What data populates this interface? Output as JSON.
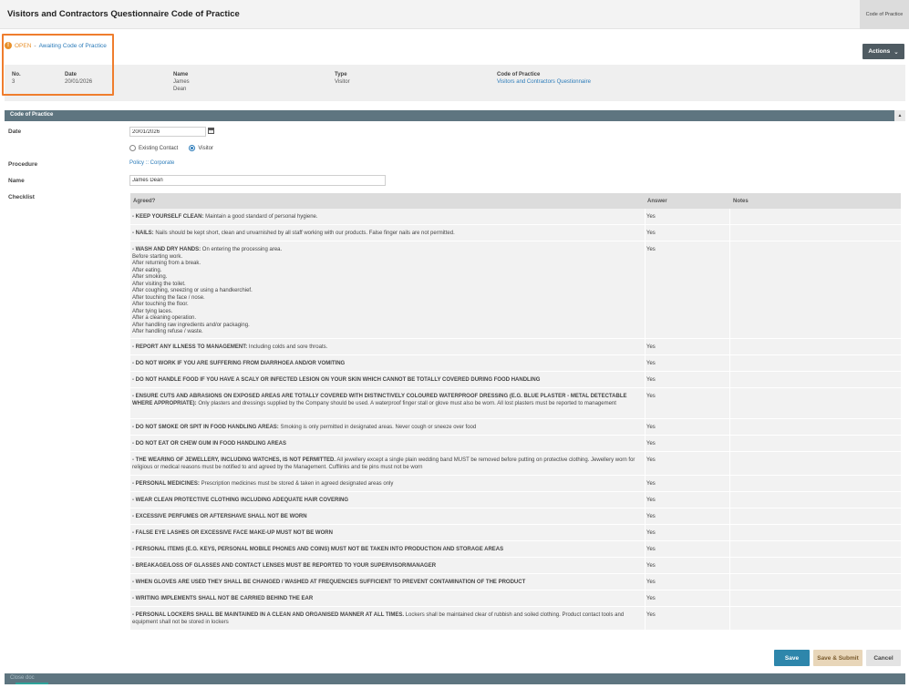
{
  "header": {
    "title": "Visitors and Contractors Questionnaire Code of Practice",
    "tab_label": "Code of Practice"
  },
  "status": {
    "icon": "!",
    "state": "OPEN",
    "separator": " - ",
    "text": "Awaiting Code of Practice"
  },
  "actions": {
    "label": "Actions",
    "caret": "⌄"
  },
  "info": {
    "no_label": "No.",
    "no_value": "3",
    "date_label": "Date",
    "date_value": "20/01/2026",
    "name_label": "Name",
    "name_first": "James",
    "name_last": "Dean",
    "type_label": "Type",
    "type_value": "Visitor",
    "cop_label": "Code of Practice",
    "cop_value": "Visitors and Contractors Questionnaire"
  },
  "section": {
    "title": "Code of Practice",
    "collapse_icon": "▲"
  },
  "form": {
    "date_label": "Date",
    "date_value": "20/01/2026",
    "radio_existing": "Existing Contact",
    "radio_visitor": "Visitor",
    "procedure_label": "Procedure",
    "procedure_value": "Policy :: Corporate",
    "name_label": "Name",
    "name_value": "James Dean",
    "checklist_label": "Checklist"
  },
  "checklist": {
    "headers": {
      "agreed": "Agreed?",
      "answer": "Answer",
      "notes": "Notes"
    },
    "rows": [
      {
        "title": "- KEEP YOURSELF CLEAN:",
        "body": " Maintain a good standard of personal hygiene.",
        "answer": "Yes"
      },
      {
        "title": "- NAILS:",
        "body": " Nails should be kept short, clean and unvarnished by all staff working with our products. False finger nails are not permitted.",
        "answer": "Yes"
      },
      {
        "title": "- WASH AND DRY HANDS:",
        "body": " On entering the processing area.\nBefore starting work.\nAfter returning from a break.\nAfter eating.\nAfter smoking.\nAfter visiting the toilet.\nAfter coughing, sneezing or using a handkerchief.\nAfter touching the face / nose.\nAfter touching the floor.\nAfter tying laces.\nAfter a cleaning operation.\nAfter handling raw ingredients and/or packaging.\nAfter handling refuse / waste.",
        "answer": "Yes"
      },
      {
        "title": "- REPORT ANY ILLNESS TO MANAGEMENT:",
        "body": " Including colds and sore throats.",
        "answer": "Yes"
      },
      {
        "title": "- DO NOT WORK IF YOU ARE SUFFERING FROM DIARRHOEA AND/OR VOMITING",
        "body": "",
        "answer": "Yes"
      },
      {
        "title": "- DO NOT HANDLE FOOD IF YOU HAVE A SCALY OR INFECTED LESION ON YOUR SKIN WHICH CANNOT BE TOTALLY COVERED DURING FOOD HANDLING",
        "body": "",
        "answer": "Yes"
      },
      {
        "title": "- ENSURE CUTS AND ABRASIONS ON EXPOSED AREAS ARE TOTALLY COVERED WITH DISTINCTIVELY COLOURED WATERPROOF DRESSING (E.G. BLUE PLASTER - METAL DETECTABLE WHERE APPROPRIATE):",
        "body": " Only plasters and dressings supplied by the Company should be used. A waterproof finger stall or glove must also be worn. All lost plasters must be reported to management",
        "answer": "Yes"
      },
      {
        "title": "- DO NOT SMOKE OR SPIT IN FOOD HANDLING AREAS:",
        "body": " Smoking is only permitted in designated areas. Never cough or sneeze over food",
        "answer": "Yes"
      },
      {
        "title": "- DO NOT EAT OR CHEW GUM IN FOOD HANDLING AREAS",
        "body": "",
        "answer": "Yes"
      },
      {
        "title": "- THE WEARING OF JEWELLERY, INCLUDING WATCHES, IS NOT PERMITTED.",
        "body": " All jewellery except a single plain wedding band MUST be removed before putting on protective clothing. Jewellery worn for religious or medical reasons must be notified to and agreed by the Management. Cufflinks and tie pins must not be worn",
        "answer": "Yes"
      },
      {
        "title": "- PERSONAL MEDICINES:",
        "body": " Prescription medicines must be stored & taken in agreed designated areas only",
        "answer": "Yes"
      },
      {
        "title": "- WEAR CLEAN PROTECTIVE CLOTHING INCLUDING ADEQUATE HAIR COVERING",
        "body": "",
        "answer": "Yes"
      },
      {
        "title": "- EXCESSIVE PERFUMES OR AFTERSHAVE SHALL NOT BE WORN",
        "body": "",
        "answer": "Yes"
      },
      {
        "title": "- FALSE EYE LASHES OR EXCESSIVE FACE MAKE-UP MUST NOT BE WORN",
        "body": "",
        "answer": "Yes"
      },
      {
        "title": "- PERSONAL ITEMS (E.G. KEYS, PERSONAL MOBILE PHONES AND COINS) MUST NOT BE TAKEN INTO PRODUCTION AND STORAGE AREAS",
        "body": "",
        "answer": "Yes"
      },
      {
        "title": "- BREAKAGE/LOSS OF GLASSES AND CONTACT LENSES MUST BE REPORTED TO YOUR SUPERVISOR/MANAGER",
        "body": "",
        "answer": "Yes"
      },
      {
        "title": "- WHEN GLOVES ARE USED THEY SHALL BE CHANGED / WASHED AT FREQUENCIES SUFFICIENT TO PREVENT CONTAMINATION OF THE PRODUCT",
        "body": "",
        "answer": "Yes"
      },
      {
        "title": "- WRITING IMPLEMENTS SHALL NOT BE CARRIED BEHIND THE EAR",
        "body": "",
        "answer": "Yes"
      },
      {
        "title": "- PERSONAL LOCKERS SHALL BE MAINTAINED IN A CLEAN AND ORGANISED MANNER AT ALL TIMES.",
        "body": " Lockers shall be maintained clear of rubbish and soiled clothing. Product contact tools and equipment shall not be stored in lockers",
        "answer": "Yes"
      }
    ]
  },
  "buttons": {
    "save": "Save",
    "save_submit": "Save & Submit",
    "cancel": "Cancel"
  },
  "bottom": {
    "text": "Close doc"
  }
}
